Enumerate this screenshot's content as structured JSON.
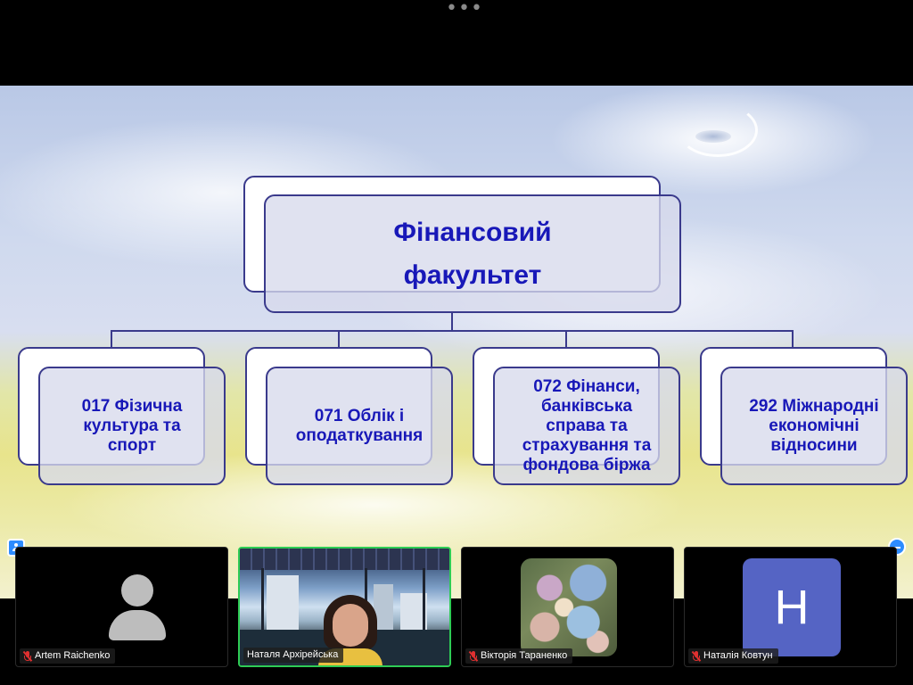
{
  "window": {
    "more_label": "•••"
  },
  "slide": {
    "main_title_line1": "Фінансовий",
    "main_title_line2": "факультет",
    "programs": [
      {
        "lines": [
          "017 Фізична",
          "культура та",
          "спорт"
        ]
      },
      {
        "lines": [
          "071 Облік і",
          "оподаткування"
        ]
      },
      {
        "lines": [
          "072 Фінанси,",
          "банківська",
          "справа та",
          "страхування та",
          "фондова біржа"
        ]
      },
      {
        "lines": [
          "292 Міжнародні",
          "економічні",
          "відносини"
        ]
      }
    ]
  },
  "participants": [
    {
      "name": "Artem Raichenko",
      "muted": true,
      "display": "avatar-placeholder"
    },
    {
      "name": "Наталя Архірейська",
      "muted": false,
      "display": "video",
      "active_speaker": true
    },
    {
      "name": "Вікторія Тараненко",
      "muted": true,
      "display": "profile-photo"
    },
    {
      "name": "Наталія Ковтун",
      "muted": true,
      "display": "initial",
      "initial": "H"
    }
  ],
  "colors": {
    "active_speaker_border": "#2ecc55",
    "accent": "#2d8cff",
    "slide_text": "#1818b8",
    "initial_avatar": "#5564c4"
  }
}
